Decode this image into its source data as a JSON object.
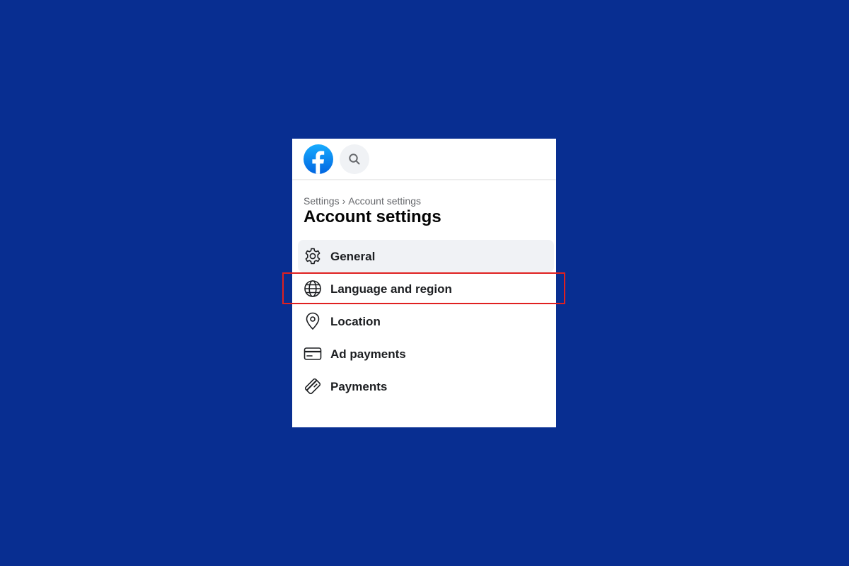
{
  "colors": {
    "background": "#082e91",
    "panel": "#ffffff",
    "brand": "#0866ff",
    "highlight": "#e02020",
    "active_item_bg": "#f0f2f5"
  },
  "header": {
    "logo_icon": "facebook-logo-icon",
    "search_icon": "search-icon"
  },
  "breadcrumb": {
    "root": "Settings",
    "separator": "›",
    "current": "Account settings"
  },
  "page_title": "Account settings",
  "menu": {
    "items": [
      {
        "label": "General",
        "icon": "gear-icon",
        "active": true
      },
      {
        "label": "Language and region",
        "icon": "globe-icon",
        "active": false,
        "highlighted": true
      },
      {
        "label": "Location",
        "icon": "location-pin-icon",
        "active": false
      },
      {
        "label": "Ad payments",
        "icon": "credit-card-icon",
        "active": false
      },
      {
        "label": "Payments",
        "icon": "payment-card-icon",
        "active": false
      }
    ]
  }
}
